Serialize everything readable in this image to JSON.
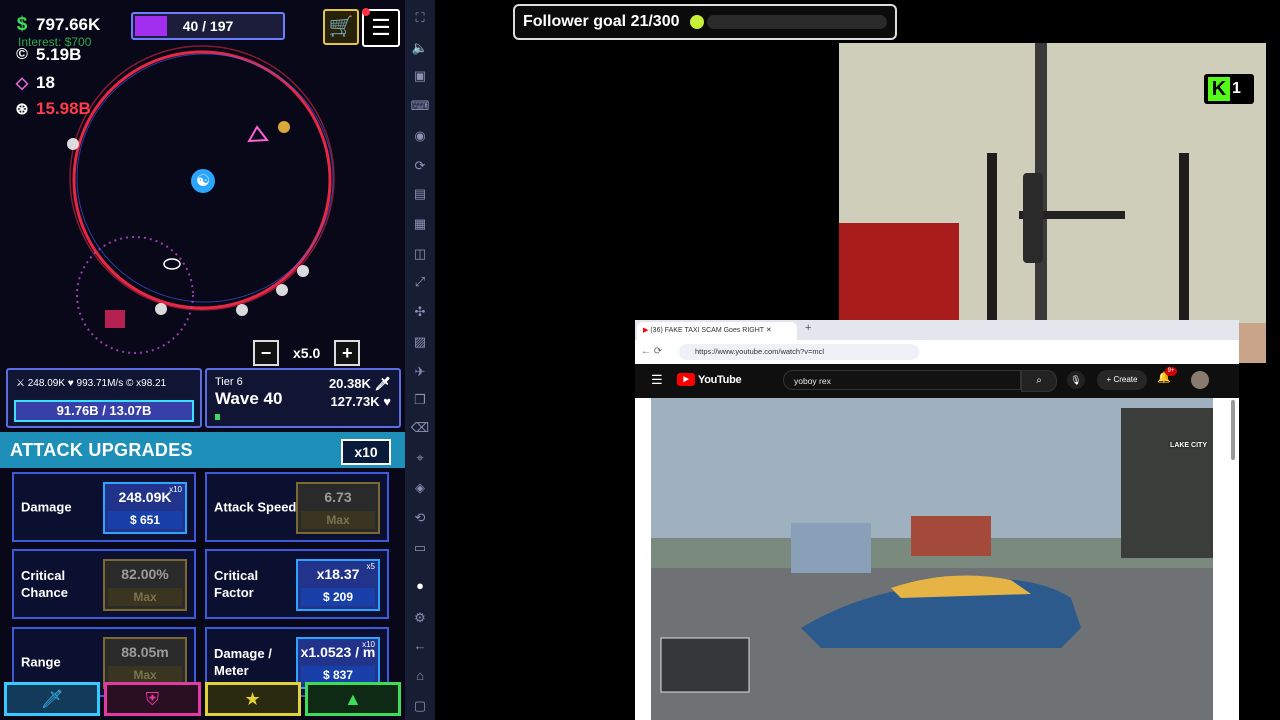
{
  "game": {
    "cash": "797.66K",
    "interest": "Interest: $700",
    "coins": "5.19B",
    "gems": "18",
    "cells": "15.98B",
    "wave_progress": "40 / 197",
    "speed": "x5.0",
    "damage_card": {
      "damage": "248.09K",
      "health": "993.71M/s",
      "mult": "x98.21",
      "hp": "91.76B / 13.07B"
    },
    "tier_card": {
      "tier": "Tier 6",
      "wave": "Wave 40",
      "enemy_damage": "20.38K",
      "enemy_health": "127.73K"
    },
    "upgrades_title": "ATTACK UPGRADES",
    "multiplier": "x10",
    "upgrades": [
      {
        "label": "Damage",
        "value": "248.09K",
        "mult": "x10",
        "cost": "$ 651"
      },
      {
        "label": "Attack Speed",
        "value": "6.73",
        "mult": "",
        "cost": "Max"
      },
      {
        "label": "Critical Chance",
        "value": "82.00%",
        "mult": "",
        "cost": "Max"
      },
      {
        "label": "Critical Factor",
        "value": "x18.37",
        "mult": "x5",
        "cost": "$ 209"
      },
      {
        "label": "Range",
        "value": "88.05m",
        "mult": "",
        "cost": "Max"
      },
      {
        "label": "Damage / Meter",
        "value": "x1.0523 / m",
        "mult": "x10",
        "cost": "$ 837"
      }
    ],
    "bottom_tabs": [
      {
        "icon": "sword-icon",
        "color": "#39c8ff"
      },
      {
        "icon": "shield-icon",
        "color": "#e23aa0"
      },
      {
        "icon": "star-icon",
        "color": "#e2d23a"
      },
      {
        "icon": "triangle-icon",
        "color": "#3ddc5a"
      }
    ]
  },
  "overlay": {
    "follower_goal": "Follower goal 21/300",
    "kick_count": "1"
  },
  "browser": {
    "tab_title": "(36) FAKE TAXI SCAM Goes RIGHT",
    "url": "https://www.youtube.com/watch?v=mcl",
    "youtube_label": "YouTube",
    "search_value": "yoboy rex",
    "create_label": "Create",
    "notif_count": "9+",
    "video_overlay": "LAKE CITY"
  }
}
